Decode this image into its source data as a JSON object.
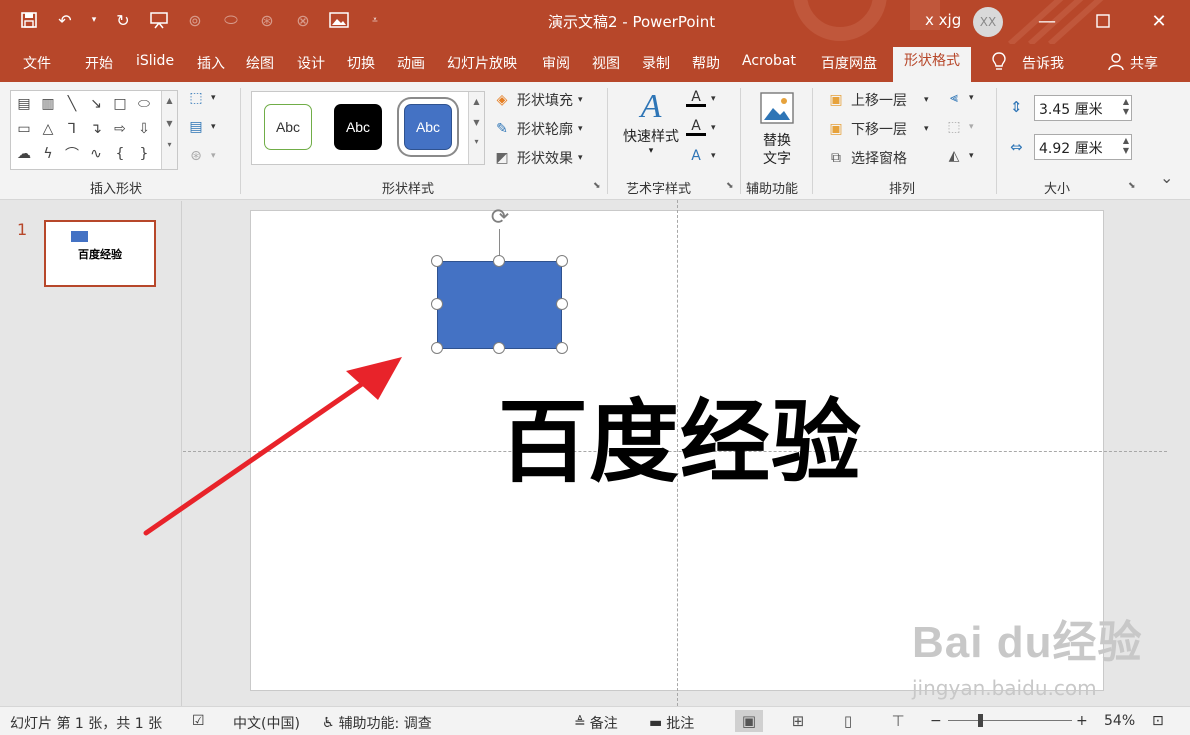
{
  "titlebar": {
    "document_title": "演示文稿2  -  PowerPoint",
    "user_name": "x xjg",
    "avatar_initials": "XX",
    "qat_icons": [
      "save-icon",
      "undo-icon",
      "redo-icon",
      "present-icon",
      "picture-icon",
      "customize-icon"
    ]
  },
  "tabs": [
    "文件",
    "开始",
    "iSlide",
    "插入",
    "绘图",
    "设计",
    "切换",
    "动画",
    "幻灯片放映",
    "审阅",
    "视图",
    "录制",
    "帮助",
    "Acrobat",
    "百度网盘",
    "形状格式",
    "告诉我",
    "共享"
  ],
  "ribbon": {
    "groups": {
      "insert_shapes": "插入形状",
      "shape_styles": "形状样式",
      "art_styles": "艺术字样式",
      "accessibility": "辅助功能",
      "arrange": "排列",
      "size": "大小"
    },
    "style_swatches": [
      "Abc",
      "Abc",
      "Abc"
    ],
    "shape_fill": "形状填充",
    "shape_outline": "形状轮廓",
    "shape_effects": "形状效果",
    "quick_styles": "快速样式",
    "alt_text_line1": "替换",
    "alt_text_line2": "文字",
    "bring_forward": "上移一层",
    "send_backward": "下移一层",
    "selection_pane": "选择窗格",
    "height_value": "3.45 厘米",
    "width_value": "4.92 厘米"
  },
  "slide_panel": {
    "slide_number": "1",
    "thumb_text": "百度经验"
  },
  "slide": {
    "main_text": "百度经验"
  },
  "watermark": {
    "logo": "Bai du经验",
    "url": "jingyan.baidu.com"
  },
  "statusbar": {
    "slide_info": "幻灯片 第 1 张，共 1 张",
    "language": "中文(中国)",
    "accessibility": "辅助功能: 调查",
    "notes": "备注",
    "comments": "批注",
    "zoom_percent": "54%"
  },
  "colors": {
    "accent": "#b7472a",
    "shape_fill": "#4472c4",
    "arrow": "#e8232a"
  }
}
